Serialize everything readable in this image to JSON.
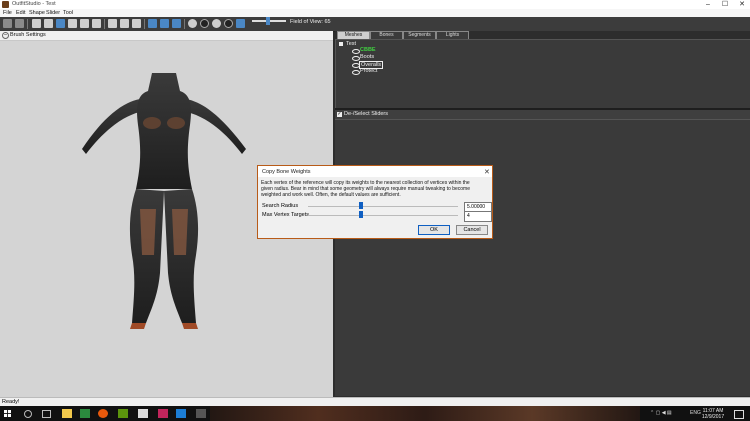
{
  "window": {
    "title": "OutfitStudio - Test",
    "controls": [
      "–",
      "☐",
      "✕"
    ]
  },
  "menu": [
    "File",
    "Edit",
    "Shape",
    "Slider",
    "Tool"
  ],
  "toolbar": {
    "field_of_view_label": "Field of View: 65",
    "field_of_view": 65
  },
  "brush_settings": {
    "toggle": "–",
    "label": "Brush Settings"
  },
  "tabs": [
    "Meshes",
    "Bones",
    "Segments",
    "Lights"
  ],
  "tree": {
    "root": "Test",
    "children": [
      {
        "label": "CBBE",
        "highlight": true
      },
      {
        "label": "Boots",
        "highlight": false
      },
      {
        "label": "Overalls",
        "highlight": false,
        "selected": true
      },
      {
        "label": "Protect",
        "highlight": false
      }
    ]
  },
  "sliders_header": {
    "checkbox": "✓",
    "label": "De-/Select Sliders"
  },
  "status": {
    "text": "Ready!"
  },
  "dialog": {
    "title": "Copy Bone Weights",
    "close": "✕",
    "description": "Each vertex of the reference will copy its weights to the nearest collection of vertices within the given radius. Bear in mind that some geometry will always require manual tweaking to become weighted and work well. Often, the default values are sufficient.",
    "search_radius_label": "Search Radius",
    "search_radius_value": "5.00000",
    "search_radius_level": 0.35,
    "max_vertex_label": "Max Vertex Targets",
    "max_vertex_value": "4",
    "max_vertex_level": 0.35,
    "ok_label": "OK",
    "cancel_label": "Cancel"
  },
  "taskbar": {
    "language": "ENG",
    "time": "11:07 AM",
    "date": "12/9/2017"
  },
  "colors": {
    "accent": "#0f5fc2",
    "tree_highlight": "#40d040",
    "dialog_border": "#b85b18",
    "viewport_bg": "#d4d4d4"
  }
}
